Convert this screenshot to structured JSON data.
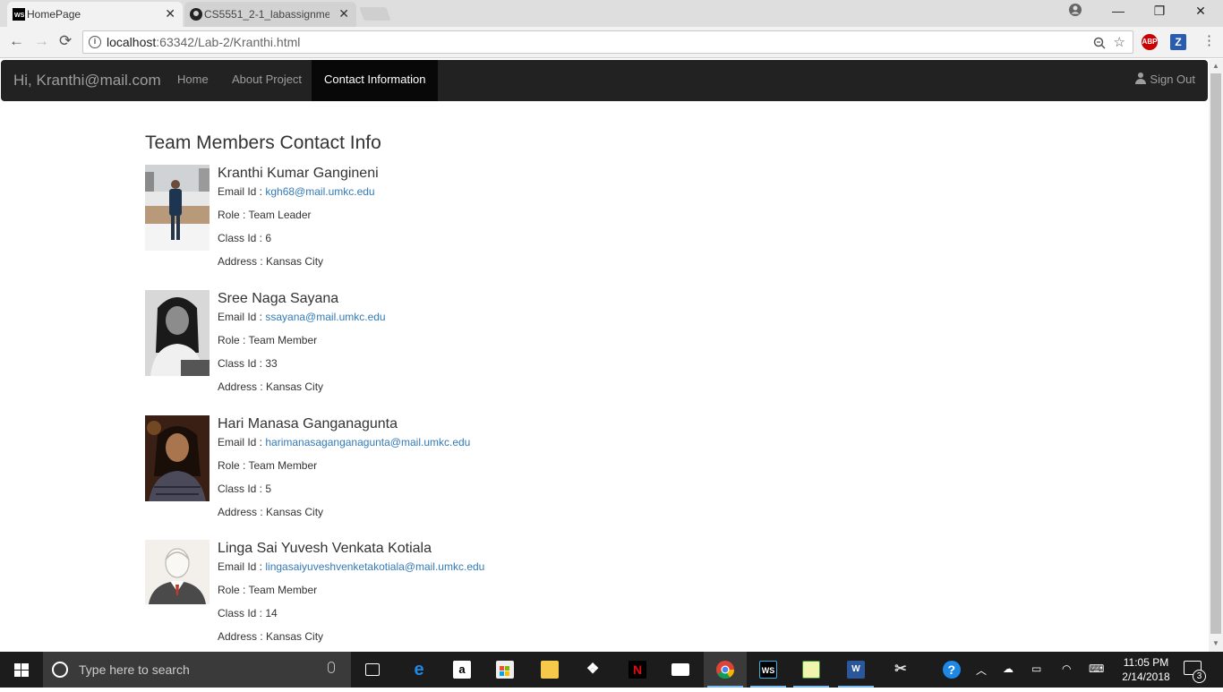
{
  "browser": {
    "tabs": [
      {
        "title": "HomePage",
        "icon": "webstorm-icon",
        "active": true
      },
      {
        "title": "CS5551_2-1_labassignme",
        "icon": "github-icon",
        "active": false
      }
    ],
    "url_host": "localhost",
    "url_path": ":63342/Lab-2/Kranthi.html",
    "extensions": [
      "ABP",
      "Z"
    ]
  },
  "navbar": {
    "brand": "Hi, Kranthi@mail.com",
    "links": [
      {
        "label": "Home",
        "active": false
      },
      {
        "label": "About Project",
        "active": false
      },
      {
        "label": "Contact Information",
        "active": true
      }
    ],
    "signout": "Sign Out"
  },
  "page": {
    "heading": "Team Members Contact Info",
    "members": [
      {
        "name": "Kranthi Kumar Gangineni",
        "email_label": "Email Id : ",
        "email": "kgh68@mail.umkc.edu",
        "role": "Role : Team Leader",
        "class_id": "Class Id : 6",
        "address": "Address : Kansas City",
        "photo": "person-standing-snow-photo"
      },
      {
        "name": "Sree Naga Sayana",
        "email_label": "Email Id : ",
        "email": "ssayana@mail.umkc.edu",
        "role": "Role : Team Member",
        "class_id": "Class Id : 33",
        "address": "Address : Kansas City",
        "photo": "grayscale-portrait-photo"
      },
      {
        "name": "Hari Manasa Ganganagunta",
        "email_label": "Email Id : ",
        "email": "harimanasaganganagunta@mail.umkc.edu",
        "role": "Role : Team Member",
        "class_id": "Class Id : 5",
        "address": "Address : Kansas City",
        "photo": "portrait-photo"
      },
      {
        "name": "Linga Sai Yuvesh Venkata Kotiala",
        "email_label": "Email Id : ",
        "email": "lingasaiyuveshvenketakotiala@mail.umkc.edu",
        "role": "Role : Team Member",
        "class_id": "Class Id : 14",
        "address": "Address : Kansas City",
        "photo": "default-avatar-illustration"
      }
    ]
  },
  "taskbar": {
    "search_placeholder": "Type here to search",
    "time": "11:05 PM",
    "date": "2/14/2018",
    "notification_count": "3"
  },
  "colors": {
    "navbar_bg": "#222222",
    "link": "#337ab7",
    "taskbar_bg": "#1c1c1c"
  }
}
